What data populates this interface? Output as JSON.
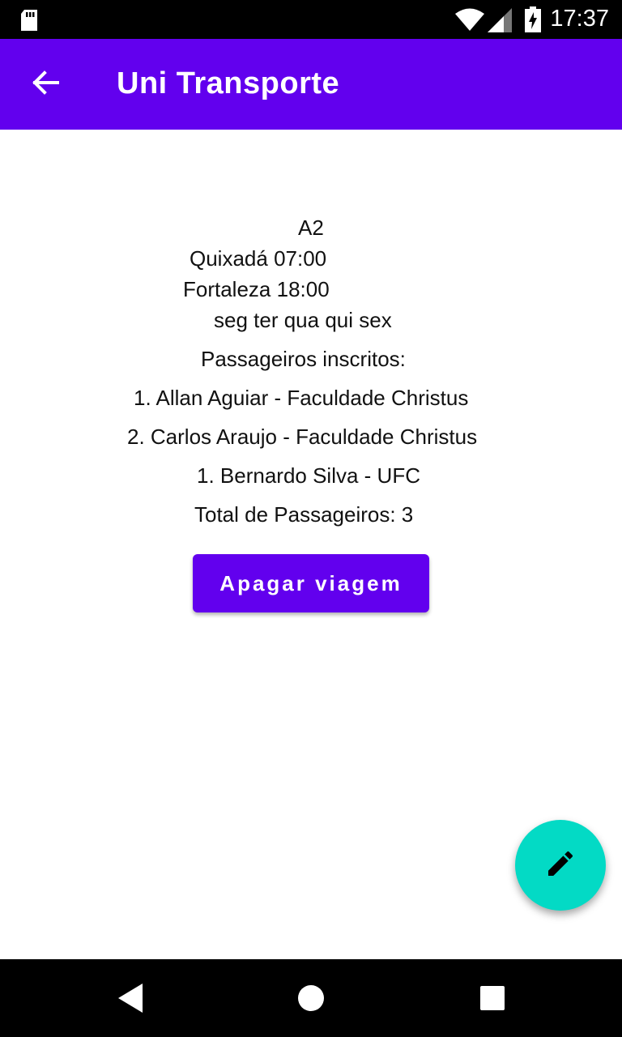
{
  "status_bar": {
    "time": "17:37"
  },
  "app_bar": {
    "title": "Uni Transporte"
  },
  "trip": {
    "name": "A2",
    "origin": "Quixadá 07:00",
    "destination": "Fortaleza 18:00",
    "days": "seg ter qua qui sex",
    "passengers_heading": "Passageiros inscritos:",
    "passengers": [
      "1. Allan Aguiar - Faculdade Christus",
      "2. Carlos Araujo - Faculdade Christus",
      "1. Bernardo Silva - UFC"
    ],
    "total": "Total de Passageiros: 3"
  },
  "actions": {
    "delete_label": "Apagar viagem"
  },
  "colors": {
    "primary": "#6200ee",
    "fab": "#03dac5"
  },
  "icons": {
    "back": "arrow-back-icon",
    "fab": "pencil-icon"
  }
}
